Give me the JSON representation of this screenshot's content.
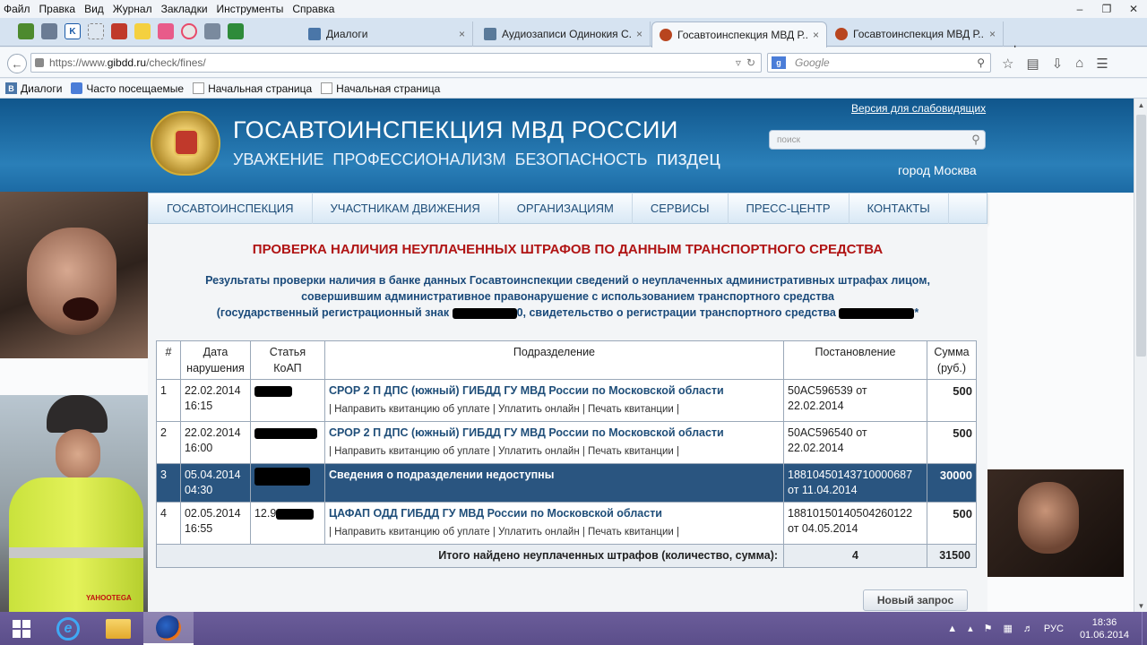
{
  "browser": {
    "menu": [
      "Файл",
      "Правка",
      "Вид",
      "Журнал",
      "Закладки",
      "Инструменты",
      "Справка"
    ],
    "window_controls": [
      "–",
      "❐",
      "✕"
    ],
    "tabs": [
      {
        "label": "Диалоги",
        "close": "×"
      },
      {
        "label": "Аудиозаписи Одинокия С...",
        "close": "×"
      },
      {
        "label": "Госавтоинспекция МВД Р...",
        "close": "×"
      },
      {
        "label": "Госавтоинспекция МВД Р...",
        "close": "×"
      }
    ],
    "new_tab": "+",
    "url": {
      "prefix": "https://www.",
      "host": "gibdd.ru",
      "path": "/check/fines/"
    },
    "search_placeholder": "Google",
    "search_engine_badge": "g",
    "bookmarks": [
      "Диалоги",
      "Часто посещаемые",
      "Начальная страница",
      "Начальная страница"
    ]
  },
  "site": {
    "title": "ГОСАВТОИНСПЕКЦИЯ МВД РОССИИ",
    "motto": [
      "УВАЖЕНИЕ",
      "ПРОФЕССИОНАЛИЗМ",
      "БЕЗОПАСНОСТЬ"
    ],
    "motto_extra": "пиздец",
    "a11y_link": "Версия для слабовидящих",
    "search_placeholder": "поиск",
    "city": "город Москва",
    "nav": [
      "ГОСАВТОИНСПЕКЦИЯ",
      "УЧАСТНИКАМ ДВИЖЕНИЯ",
      "ОРГАНИЗАЦИЯМ",
      "СЕРВИСЫ",
      "ПРЕСС-ЦЕНТР",
      "КОНТАКТЫ"
    ]
  },
  "content": {
    "heading": "ПРОВЕРКА НАЛИЧИЯ НЕУПЛАЧЕННЫХ ШТРАФОВ ПО ДАННЫМ ТРАНСПОРТНОГО СРЕДСТВА",
    "intro_line1": "Результаты проверки наличия в банке данных Госавтоинспекции сведений о неуплаченных административных штрафах лицом,",
    "intro_line2": "совершившим административное правонарушение с использованием транспортного средства",
    "intro_line3a": "(государственный регистрационный знак",
    "intro_line3b": "0, свидетельство о регистрации транспортного средства",
    "intro_line3c": "*",
    "table_headers": {
      "num": "#",
      "date": "Дата нарушения",
      "article": "Статья КоАП",
      "unit": "Подразделение",
      "decree": "Постановление",
      "sum": "Сумма (руб.)"
    },
    "fines": [
      {
        "num": "1",
        "date": "22.02.2014 16:15",
        "article": "",
        "unit": "СРОР 2 П ДПС (южный) ГИБДД ГУ МВД России по Московской области",
        "links": "| Направить квитанцию об уплате  | Уплатить онлайн  | Печать квитанции |",
        "decree": "50АС596539 от 22.02.2014",
        "sum": "500"
      },
      {
        "num": "2",
        "date": "22.02.2014 16:00",
        "article": "",
        "unit": "СРОР 2 П ДПС (южный) ГИБДД ГУ МВД России по Московской области",
        "links": "| Направить квитанцию об уплате  | Уплатить онлайн  | Печать квитанции |",
        "decree": "50АС596540 от 22.02.2014",
        "sum": "500"
      },
      {
        "num": "3",
        "date": "05.04.2014 04:30",
        "article": "",
        "unit": "Сведения о подразделении недоступны",
        "links": "",
        "decree": "18810450143710000687 от 11.04.2014",
        "sum": "30000"
      },
      {
        "num": "4",
        "date": "02.05.2014 16:55",
        "article": "12.9",
        "unit": "ЦАФАП ОДД ГИБДД ГУ МВД России по Московской области",
        "links": "| Направить квитанцию об уплате  | Уплатить онлайн  | Печать квитанции |",
        "decree": "18810150140504260122 от 04.05.2014",
        "sum": "500"
      }
    ],
    "total_label": "Итого найдено неуплаченных штрафов (количество, сумма):",
    "total_count": "4",
    "total_sum": "31500",
    "new_request": "Новый запрос",
    "photo_watermark": "YAHOOTEGA"
  },
  "taskbar": {
    "lang": "РУС",
    "time": "18:36",
    "date": "01.06.2014"
  }
}
